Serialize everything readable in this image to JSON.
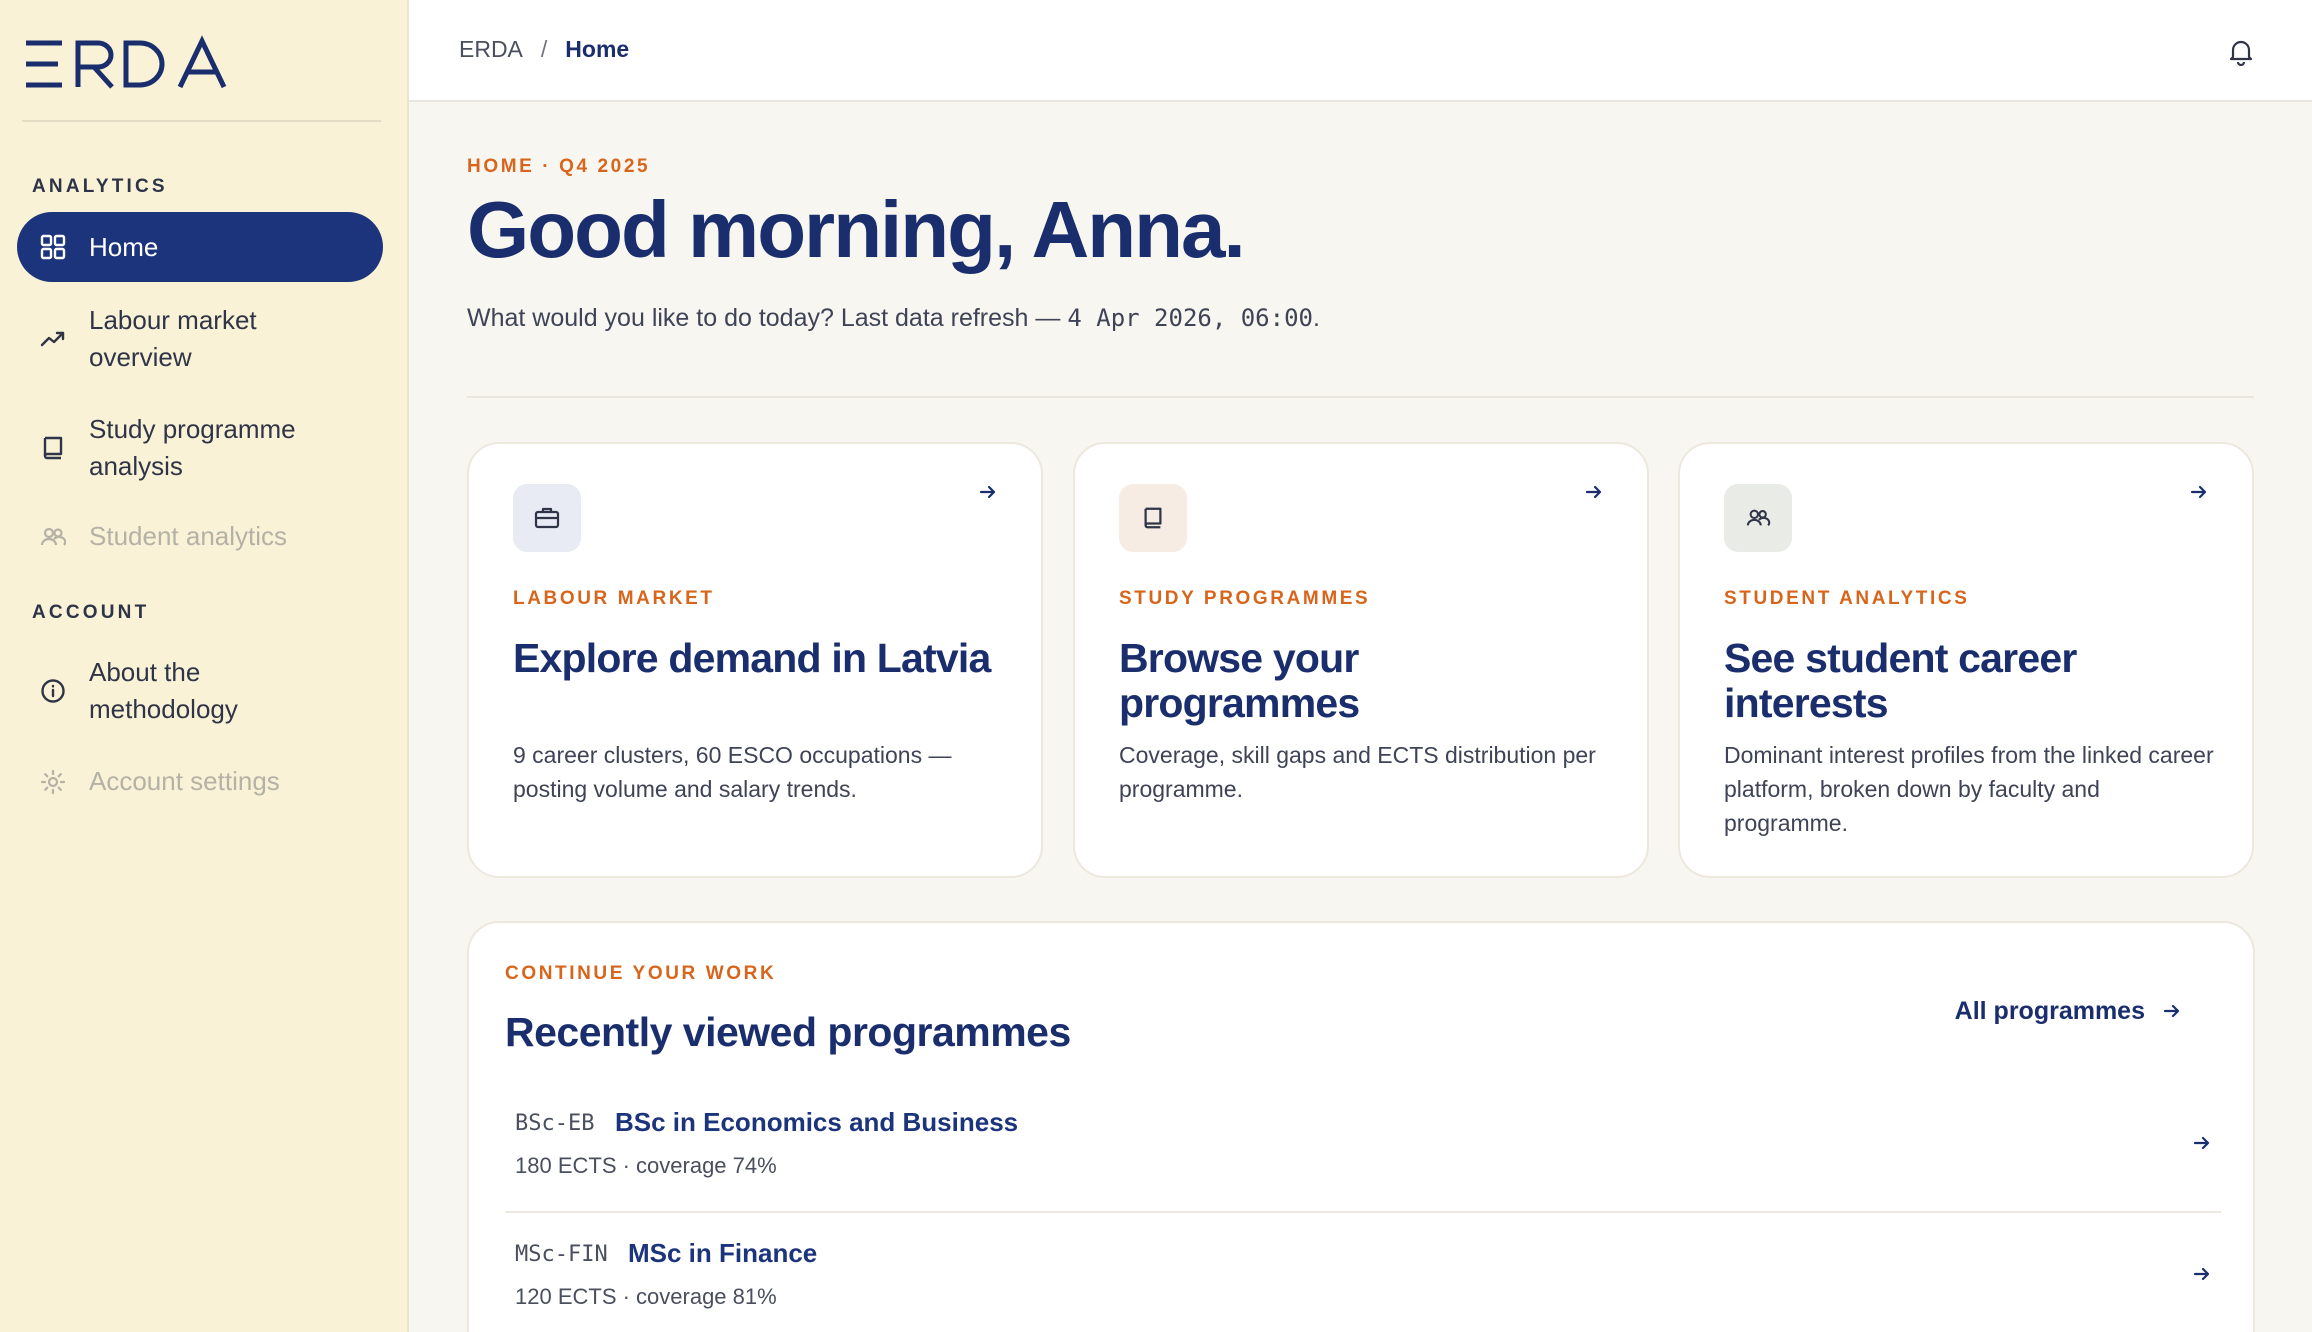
{
  "brand": {
    "logo_text": "ERDA",
    "navy": "#1a2e6e",
    "accent_orange": "#d8651c",
    "sidebar_bg": "#faf2d6"
  },
  "sidebar": {
    "sections": [
      {
        "label": "ANALYTICS"
      },
      {
        "label": "ACCOUNT"
      }
    ],
    "items": [
      {
        "label": "Home",
        "icon": "grid-icon",
        "state": "active"
      },
      {
        "label": "Labour market overview",
        "line1": "Labour market",
        "line2": "overview",
        "icon": "trend-up-icon",
        "state": "default"
      },
      {
        "label": "Study programme analysis",
        "line1": "Study programme",
        "line2": "analysis",
        "icon": "book-icon",
        "state": "default"
      },
      {
        "label": "Student analytics",
        "icon": "users-icon",
        "state": "disabled"
      },
      {
        "label": "About the methodology",
        "line1": "About the",
        "line2": "methodology",
        "icon": "info-icon",
        "state": "default"
      },
      {
        "label": "Account settings",
        "icon": "gear-icon",
        "state": "disabled"
      }
    ]
  },
  "topbar": {
    "breadcrumb": {
      "root": "ERDA",
      "separator": "/",
      "current": "Home"
    },
    "bell_icon": "bell-icon"
  },
  "hero": {
    "eyebrow": "HOME · Q4 2025",
    "greeting": "Good morning, Anna.",
    "subline_prefix": "What would you like to do today? Last data refresh — ",
    "refresh_timestamp": "4 Apr 2026, 06:00",
    "subline_suffix": "."
  },
  "cards": [
    {
      "icon": "briefcase-icon",
      "icon_bg": "#e8ebf3",
      "eyebrow": "LABOUR MARKET",
      "title": "Explore demand in Latvia",
      "description": "9 career clusters, 60 ESCO occupations — posting volume and salary trends."
    },
    {
      "icon": "book-icon",
      "icon_bg": "#f6ece4",
      "eyebrow": "STUDY PROGRAMMES",
      "title": "Browse your programmes",
      "description": "Coverage, skill gaps and ECTS distribution per programme."
    },
    {
      "icon": "users-icon",
      "icon_bg": "#e9ece6",
      "eyebrow": "STUDENT ANALYTICS",
      "title": "See student career interests",
      "description": "Dominant interest profiles from the linked career platform, broken down by faculty and programme."
    }
  ],
  "recent": {
    "eyebrow": "CONTINUE YOUR WORK",
    "title": "Recently viewed programmes",
    "all_link": "All programmes",
    "programmes": [
      {
        "code": "BSc-EB",
        "name": "BSc in Economics and Business",
        "meta": "180 ECTS · coverage 74%"
      },
      {
        "code": "MSc-FIN",
        "name": "MSc in Finance",
        "meta": "120 ECTS · coverage 81%"
      }
    ]
  }
}
